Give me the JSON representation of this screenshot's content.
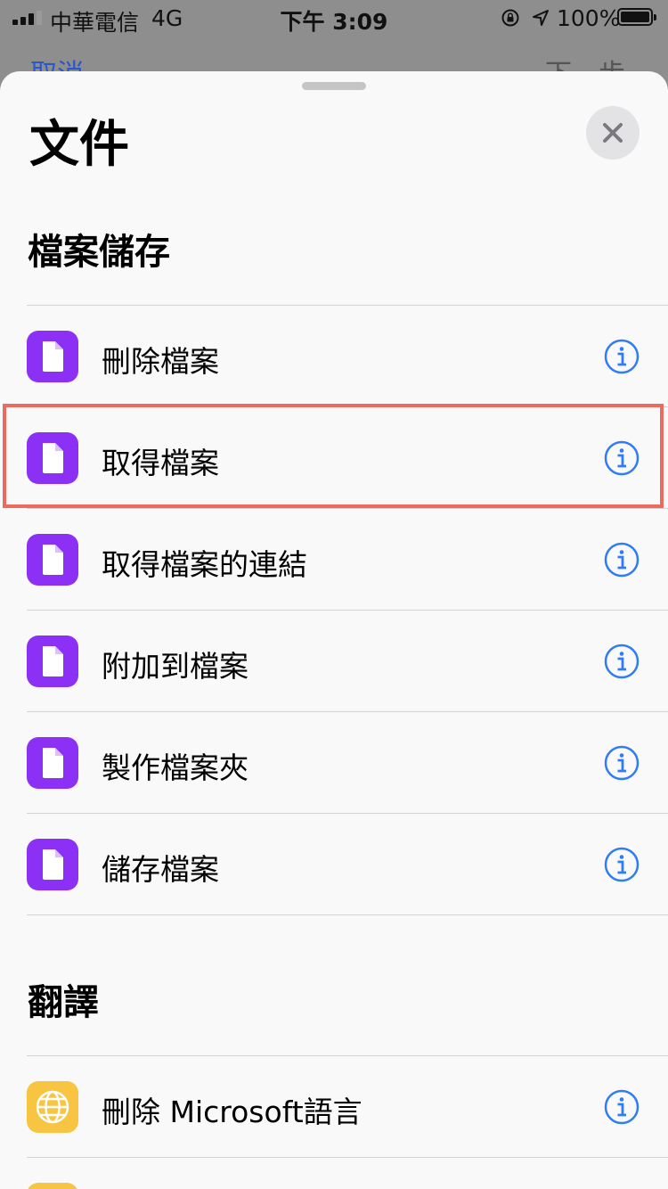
{
  "status_bar": {
    "carrier": "中華電信",
    "network": "4G",
    "time": "下午 3:09",
    "battery_percent": "100%"
  },
  "background_nav": {
    "left_label": "取消",
    "right_label": "下一步"
  },
  "sheet": {
    "title": "文件",
    "close_icon": "close-icon"
  },
  "sections": [
    {
      "header": "檔案儲存",
      "items": [
        {
          "label": "刪除檔案",
          "icon": "file-icon",
          "icon_color": "#8c30f5",
          "highlighted": false
        },
        {
          "label": "取得檔案",
          "icon": "file-icon",
          "icon_color": "#8c30f5",
          "highlighted": true
        },
        {
          "label": "取得檔案的連結",
          "icon": "file-icon",
          "icon_color": "#8c30f5",
          "highlighted": false
        },
        {
          "label": "附加到檔案",
          "icon": "file-icon",
          "icon_color": "#8c30f5",
          "highlighted": false
        },
        {
          "label": "製作檔案夾",
          "icon": "file-icon",
          "icon_color": "#8c30f5",
          "highlighted": false
        },
        {
          "label": "儲存檔案",
          "icon": "file-icon",
          "icon_color": "#8c30f5",
          "highlighted": false
        }
      ]
    },
    {
      "header": "翻譯",
      "items": [
        {
          "label": "刪除 Microsoft語言",
          "icon": "globe-icon",
          "icon_color": "#f7c542",
          "highlighted": false
        }
      ]
    }
  ],
  "colors": {
    "accent": "#2f7cf6",
    "highlight_border": "#ec6a5e"
  }
}
